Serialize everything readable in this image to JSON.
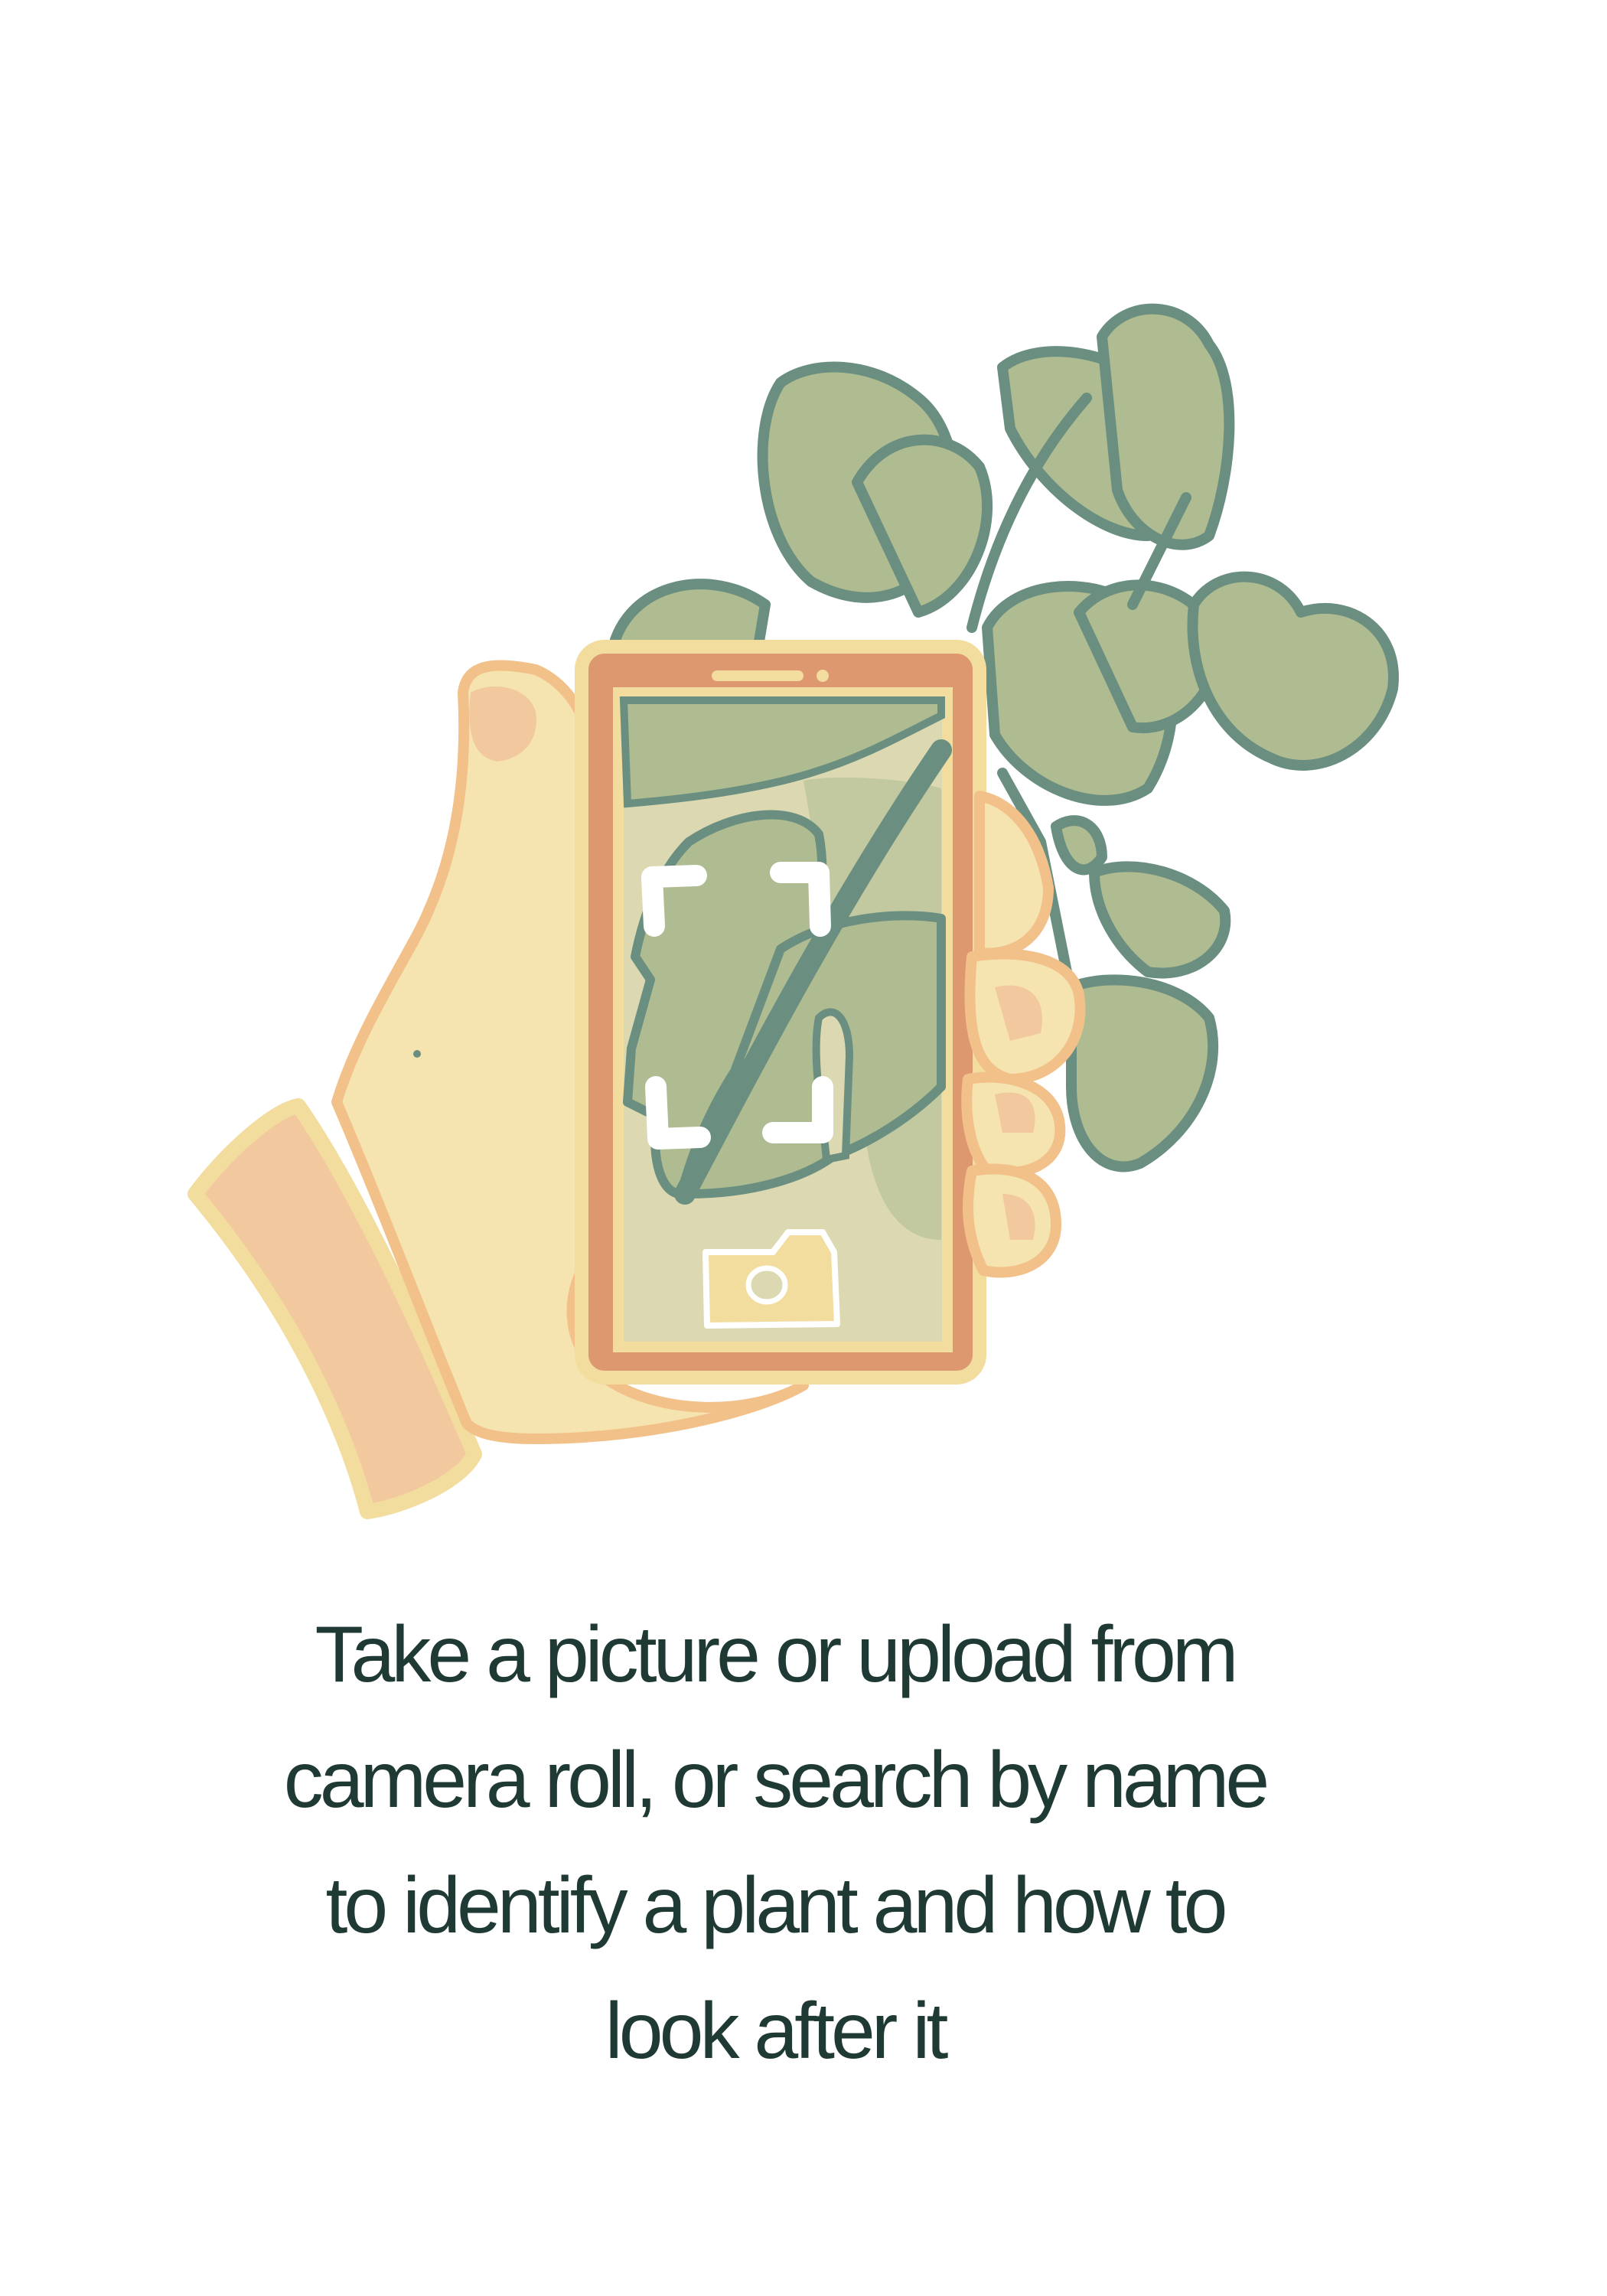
{
  "onboarding": {
    "caption_lines": [
      "Take a picture or upload from",
      "camera roll, or search by name",
      "to identify a plant and how to",
      "look after it"
    ]
  },
  "illustration": {
    "subject": "hand holding phone scanning monstera leaf",
    "icons": [
      "scan-frame-icon",
      "camera-icon",
      "monstera-leaf-icon"
    ]
  },
  "colors": {
    "background": "#ffffff",
    "text": "#1f3a34",
    "leaf_fill": "#afbb91",
    "leaf_stroke": "#6a8f80",
    "skin": "#f5e4b0",
    "skin_outline": "#f2c18a",
    "cuff": "#f2c89e",
    "phone_body": "#dd9870",
    "phone_rim": "#f2dc9e",
    "screen_bg": "#dcd9b2"
  }
}
